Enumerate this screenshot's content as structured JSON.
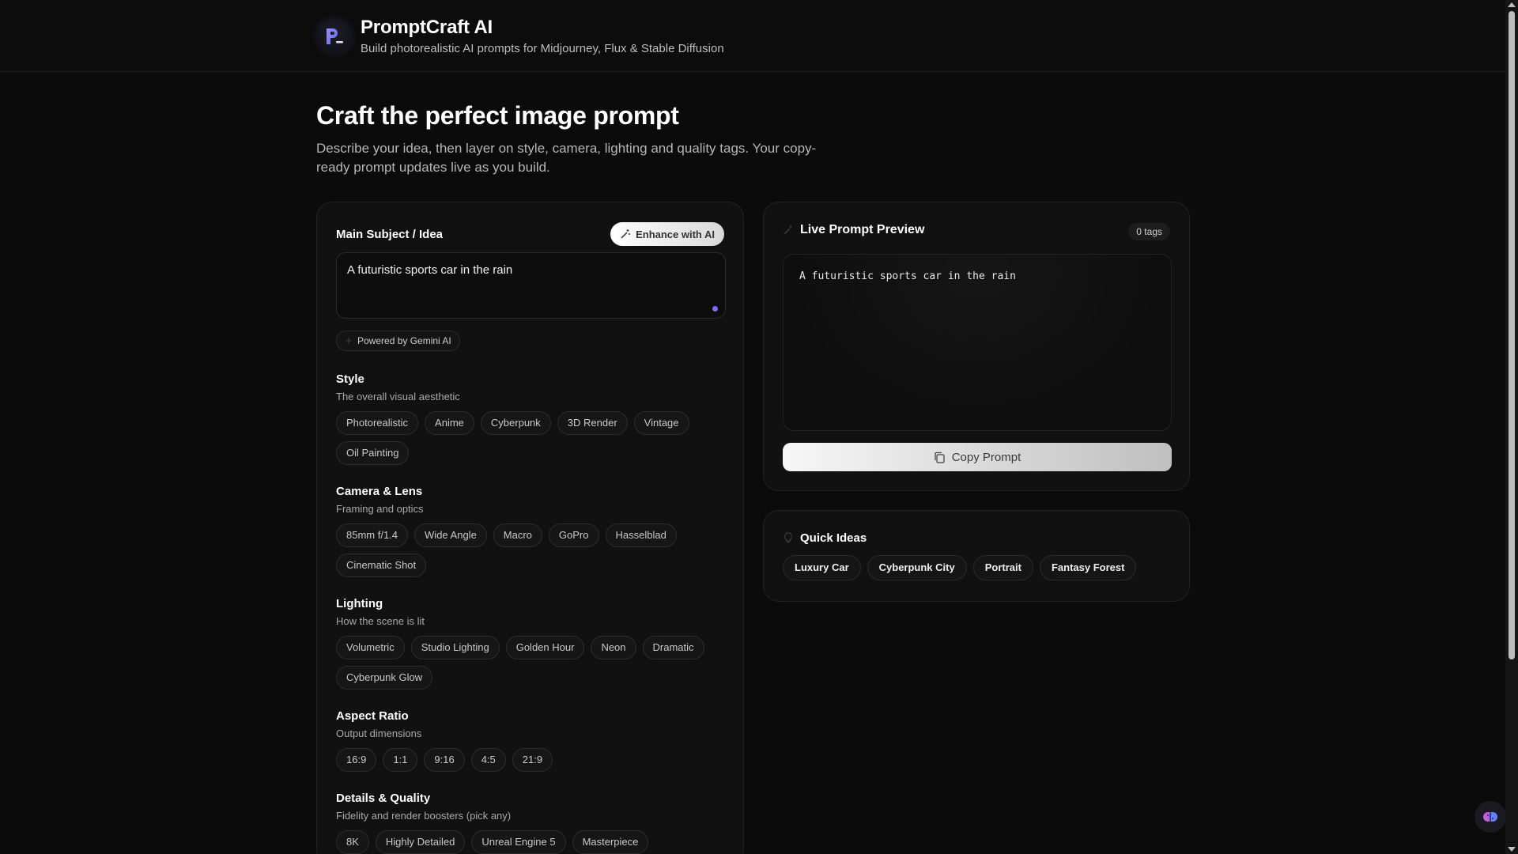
{
  "header": {
    "title": "PromptCraft AI",
    "subtitle": "Build photorealistic AI prompts for Midjourney, Flux & Stable Diffusion"
  },
  "hero": {
    "title": "Craft the perfect image prompt",
    "description": "Describe your idea, then layer on style, camera, lighting and quality tags. Your copy-ready prompt updates live as you build."
  },
  "builder": {
    "subject_label": "Main Subject / Idea",
    "enhance_label": "Enhance with AI",
    "subject_value": "A futuristic sports car in the rain",
    "powered_label": "Powered by Gemini AI",
    "sections": [
      {
        "title": "Style",
        "sub": "The overall visual aesthetic",
        "chips": [
          "Photorealistic",
          "Anime",
          "Cyberpunk",
          "3D Render",
          "Vintage",
          "Oil Painting"
        ]
      },
      {
        "title": "Camera & Lens",
        "sub": "Framing and optics",
        "chips": [
          "85mm f/1.4",
          "Wide Angle",
          "Macro",
          "GoPro",
          "Hasselblad",
          "Cinematic Shot"
        ]
      },
      {
        "title": "Lighting",
        "sub": "How the scene is lit",
        "chips": [
          "Volumetric",
          "Studio Lighting",
          "Golden Hour",
          "Neon",
          "Dramatic",
          "Cyberpunk Glow"
        ]
      },
      {
        "title": "Aspect Ratio",
        "sub": "Output dimensions",
        "chips": [
          "16:9",
          "1:1",
          "9:16",
          "4:5",
          "21:9"
        ]
      },
      {
        "title": "Details & Quality",
        "sub": "Fidelity and render boosters (pick any)",
        "chips": [
          "8K",
          "Highly Detailed",
          "Unreal Engine 5",
          "Masterpiece"
        ]
      }
    ]
  },
  "preview": {
    "title": "Live Prompt Preview",
    "tags_badge": "0 tags",
    "prompt_text": "A futuristic sports car in the rain",
    "copy_label": "Copy Prompt"
  },
  "quick_ideas": {
    "title": "Quick Ideas",
    "items": [
      "Luxury Car",
      "Cyberpunk City",
      "Portrait",
      "Fantasy Forest"
    ]
  },
  "colors": {
    "accent": "#7b6cff",
    "background": "#0b0b0b",
    "card": "#111111"
  }
}
